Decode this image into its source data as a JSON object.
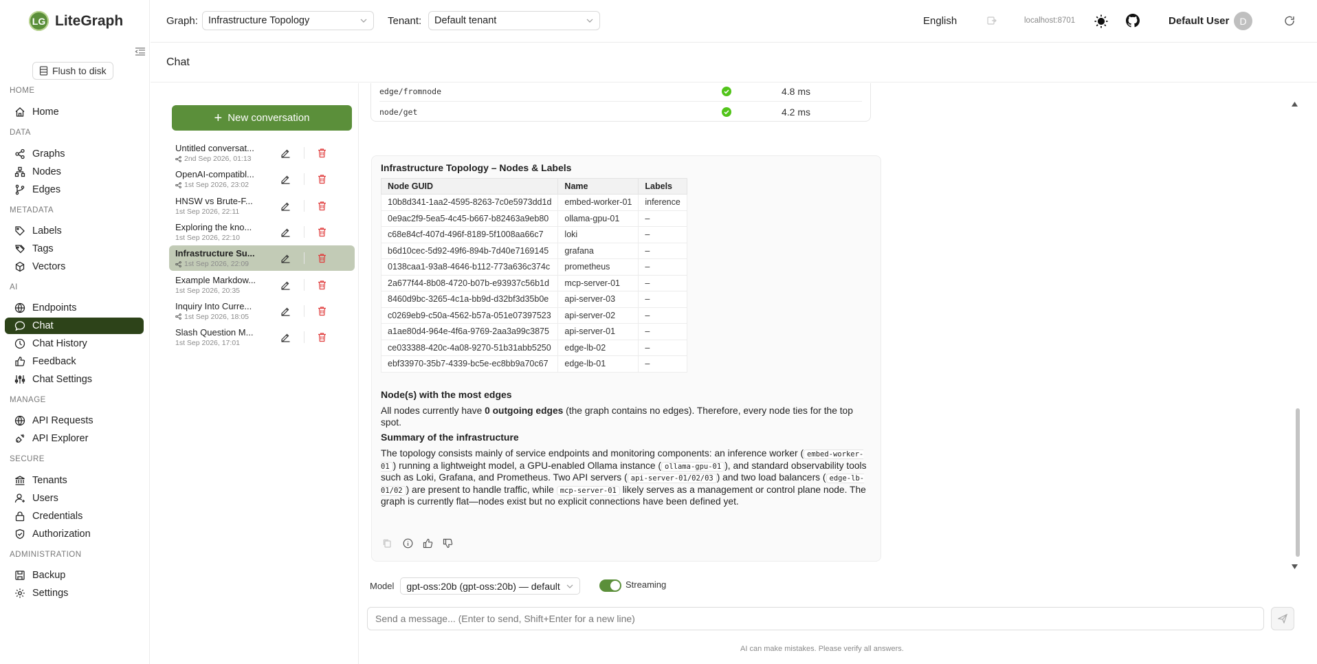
{
  "app": {
    "logo_initials": "LG",
    "name": "LiteGraph"
  },
  "sidebar": {
    "flush_label": "Flush to disk",
    "sections": {
      "home": "HOME",
      "data": "DATA",
      "metadata": "METADATA",
      "ai": "AI",
      "manage": "MANAGE",
      "secure": "SECURE",
      "administration": "ADMINISTRATION"
    },
    "items": {
      "home": "Home",
      "graphs": "Graphs",
      "nodes": "Nodes",
      "edges": "Edges",
      "labels": "Labels",
      "tags": "Tags",
      "vectors": "Vectors",
      "endpoints": "Endpoints",
      "chat": "Chat",
      "chat_history": "Chat History",
      "feedback": "Feedback",
      "chat_settings": "Chat Settings",
      "api_requests": "API Requests",
      "api_explorer": "API Explorer",
      "tenants": "Tenants",
      "users": "Users",
      "credentials": "Credentials",
      "authorization": "Authorization",
      "backup": "Backup",
      "settings": "Settings"
    },
    "active_item": "Chat"
  },
  "topbar": {
    "graph_label": "Graph:",
    "graph_value": "Infrastructure Topology",
    "tenant_label": "Tenant:",
    "tenant_value": "Default tenant",
    "language": "English",
    "host": "localhost:8701",
    "user_name": "Default User",
    "user_initial": "D"
  },
  "page": {
    "title": "Chat"
  },
  "conversations": {
    "new_label": "New conversation",
    "items": [
      {
        "title": "Untitled conversat...",
        "date": "2nd Sep 2026, 01:13",
        "shared": true
      },
      {
        "title": "OpenAI-compatibl...",
        "date": "1st Sep 2026, 23:02",
        "shared": true
      },
      {
        "title": "HNSW vs Brute-F...",
        "date": "1st Sep 2026, 22:11",
        "shared": false
      },
      {
        "title": "Exploring the kno...",
        "date": "1st Sep 2026, 22:10",
        "shared": false
      },
      {
        "title": "Infrastructure Su...",
        "date": "1st Sep 2026, 22:09",
        "shared": true
      },
      {
        "title": "Example Markdow...",
        "date": "1st Sep 2026, 20:35",
        "shared": false
      },
      {
        "title": "Inquiry Into Curre...",
        "date": "1st Sep 2026, 18:05",
        "shared": true
      },
      {
        "title": "Slash Question M...",
        "date": "1st Sep 2026, 17:01",
        "shared": false
      }
    ],
    "active_index": 4
  },
  "tool_calls": [
    {
      "name": "edge/fromnode",
      "status": "success",
      "time": "4.8 ms"
    },
    {
      "name": "node/get",
      "status": "success",
      "time": "4.2 ms"
    }
  ],
  "message": {
    "heading": "Infrastructure Topology – Nodes & Labels",
    "table": {
      "headers": [
        "Node GUID",
        "Name",
        "Labels"
      ],
      "rows": [
        [
          "10b8d341-1aa2-4595-8263-7c0e5973dd1d",
          "embed-worker-01",
          "inference"
        ],
        [
          "0e9ac2f9-5ea5-4c45-b667-b82463a9eb80",
          "ollama-gpu-01",
          "–"
        ],
        [
          "c68e84cf-407d-496f-8189-5f1008aa66c7",
          "loki",
          "–"
        ],
        [
          "b6d10cec-5d92-49f6-894b-7d40e7169145",
          "grafana",
          "–"
        ],
        [
          "0138caa1-93a8-4646-b112-773a636c374c",
          "prometheus",
          "–"
        ],
        [
          "2a677f44-8b08-4720-b07b-e93937c56b1d",
          "mcp-server-01",
          "–"
        ],
        [
          "8460d9bc-3265-4c1a-bb9d-d32bf3d35b0e",
          "api-server-03",
          "–"
        ],
        [
          "c0269eb9-c50a-4562-b57a-051e07397523",
          "api-server-02",
          "–"
        ],
        [
          "a1ae80d4-964e-4f6a-9769-2aa3a99c3875",
          "api-server-01",
          "–"
        ],
        [
          "ce033388-420c-4a08-9270-51b31abb5250",
          "edge-lb-02",
          "–"
        ],
        [
          "ebf33970-35b7-4339-bc5e-ec8bb9a70c67",
          "edge-lb-01",
          "–"
        ]
      ]
    },
    "edges_heading": "Node(s) with the most edges",
    "edges_text_pre": "All nodes currently have ",
    "edges_text_bold": "0 outgoing edges",
    "edges_text_post": " (the graph contains no edges). Therefore, every node ties for the top spot.",
    "summary_heading": "Summary of the infrastructure",
    "summary": {
      "s1": "The topology consists mainly of service endpoints and monitoring components: an inference worker (",
      "c1": "embed-worker-01",
      "s2": ") running a lightweight model, a GPU-enabled Ollama instance (",
      "c2": "ollama-gpu-01",
      "s3": "), and standard observability tools such as Loki, Grafana, and Prometheus. Two API servers (",
      "c3": "api-server-01/02/03",
      "s4": ") and two load balancers (",
      "c4": "edge-lb-01/02",
      "s5": ") are present to handle traffic, while ",
      "c5": "mcp-server-01",
      "s6": " likely serves as a management or control plane node. The graph is currently flat—nodes exist but no explicit connections have been defined yet."
    }
  },
  "composer": {
    "model_label": "Model",
    "model_value": "gpt-oss:20b (gpt-oss:20b) — default",
    "streaming_label": "Streaming",
    "streaming_on": true,
    "placeholder": "Send a message... (Enter to send, Shift+Enter for a new line)",
    "disclaimer": "AI can make mistakes. Please verify all answers."
  },
  "colors": {
    "accent": "#5b8f3a",
    "nav_active": "#2d4319",
    "delete": "#e03c3c",
    "success": "#52c41a"
  }
}
